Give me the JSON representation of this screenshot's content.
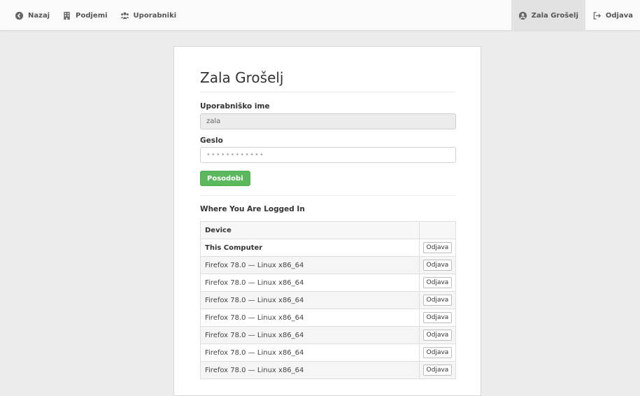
{
  "nav": {
    "back_label": "Nazaj",
    "back_icon": "chevron-left-circle-icon",
    "companies_label": "Podjemi",
    "companies_icon": "building-icon",
    "users_label": "Uporabniki",
    "users_icon": "users-icon",
    "user_label": "Zala Grošelj",
    "user_icon": "user-circle-icon",
    "logout_label": "Odjava",
    "logout_icon": "sign-out-icon"
  },
  "profile": {
    "title": "Zala Grošelj",
    "username_label": "Uporabniško ime",
    "username_value": "zala",
    "password_label": "Geslo",
    "password_placeholder": "••••••••••••",
    "update_button": "Posodobi"
  },
  "sessions": {
    "title": "Where You Are Logged In",
    "column_device": "Device",
    "logout_button": "Odjava",
    "rows": [
      {
        "device": "This Computer",
        "bold": true
      },
      {
        "device": "Firefox 78.0 — Linux x86_64"
      },
      {
        "device": "Firefox 78.0 — Linux x86_64"
      },
      {
        "device": "Firefox 78.0 — Linux x86_64"
      },
      {
        "device": "Firefox 78.0 — Linux x86_64"
      },
      {
        "device": "Firefox 78.0 — Linux x86_64"
      },
      {
        "device": "Firefox 78.0 — Linux x86_64"
      },
      {
        "device": "Firefox 78.0 — Linux x86_64"
      }
    ]
  },
  "colors": {
    "primary_button": "#5cb85c",
    "background": "#ececec",
    "topbar": "#fafafa"
  }
}
